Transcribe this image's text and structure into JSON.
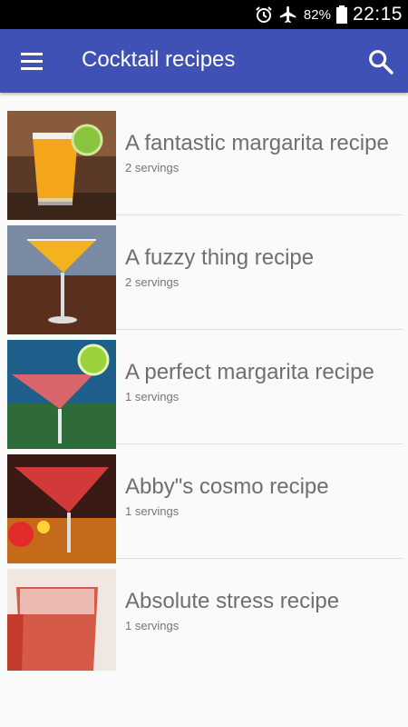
{
  "status_bar": {
    "battery_percent": "82%",
    "time": "22:15",
    "icons": [
      "alarm-icon",
      "airplane-mode-icon",
      "battery-icon"
    ]
  },
  "app_bar": {
    "title": "Cocktail recipes",
    "menu_icon": "hamburger-menu-icon",
    "search_icon": "search-icon",
    "color": "#3f51b5"
  },
  "recipes": [
    {
      "title": "A fantastic margarita recipe",
      "servings": "2 servings"
    },
    {
      "title": "A fuzzy thing recipe",
      "servings": "2 servings"
    },
    {
      "title": "A perfect margarita recipe",
      "servings": "1 servings"
    },
    {
      "title": "Abby\"s cosmo recipe",
      "servings": "1 servings"
    },
    {
      "title": "Absolute stress  recipe",
      "servings": "1 servings"
    }
  ]
}
